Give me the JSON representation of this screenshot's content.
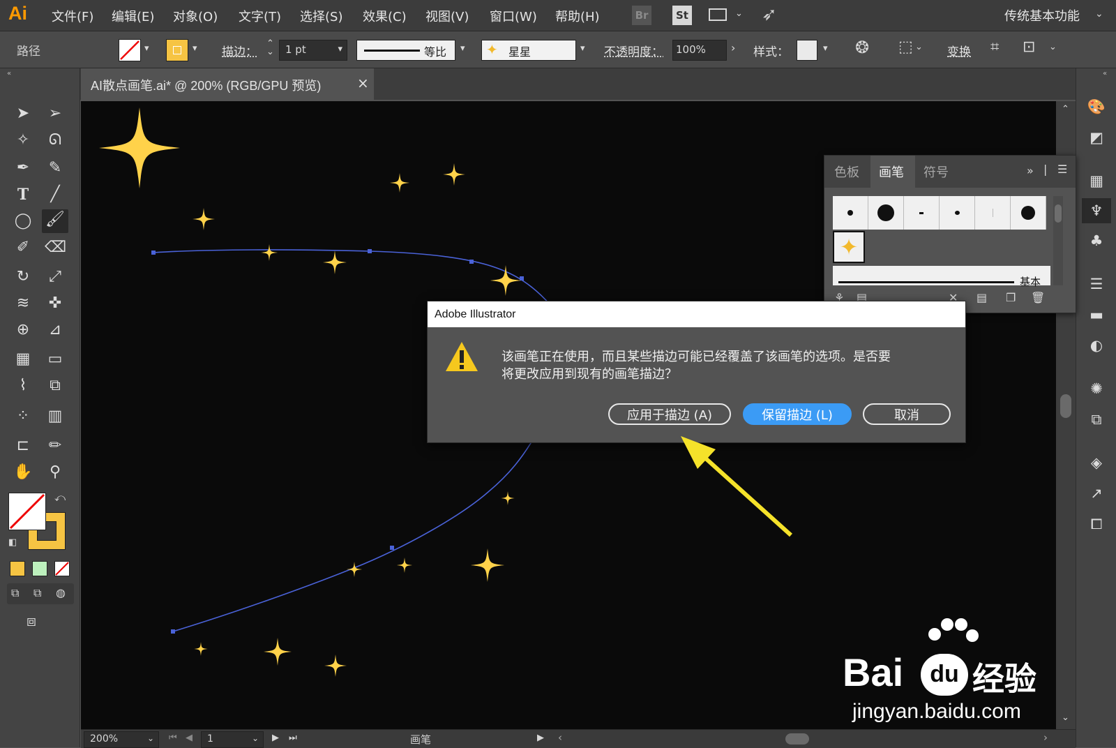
{
  "app": {
    "logo": "Ai"
  },
  "menu": [
    "文件(F)",
    "编辑(E)",
    "对象(O)",
    "文字(T)",
    "选择(S)",
    "效果(C)",
    "视图(V)",
    "窗口(W)",
    "帮助(H)"
  ],
  "header_right": {
    "br": "Br",
    "st": "St",
    "workspace": "传统基本功能"
  },
  "control": {
    "path_label": "路径",
    "stroke_label": "描边：",
    "stroke_weight": "1 pt",
    "profile_label": "等比",
    "brush_name": "星星",
    "opacity_label": "不透明度：",
    "opacity_value": "100%",
    "style_label": "样式：",
    "transform_label": "变换"
  },
  "document": {
    "tab_title": "AI散点画笔.ai* @ 200% (RGB/GPU 预览)",
    "close": "×"
  },
  "panel": {
    "tabs": [
      "色板",
      "画笔",
      "符号"
    ],
    "active_tab": "画笔",
    "basic_label": "基本"
  },
  "dialog": {
    "title": "Adobe Illustrator",
    "message_line1": "该画笔正在使用，而且某些描边可能已经覆盖了该画笔的选项。是否要",
    "message_line2": "将更改应用到现有的画笔描边？",
    "buttons": {
      "apply": "应用于描边 (A)",
      "keep": "保留描边 (L)",
      "cancel": "取消"
    }
  },
  "status": {
    "zoom": "200%",
    "artboard": "1",
    "tool_name": "画笔"
  },
  "watermark": {
    "brand": "Bai",
    "brand2": "经验",
    "url": "jingyan.baidu.com"
  },
  "colors": {
    "star": "#ffd24a",
    "path": "#4a62d8",
    "accent_button": "#3b9bf5",
    "arrow": "#f5e22a"
  }
}
